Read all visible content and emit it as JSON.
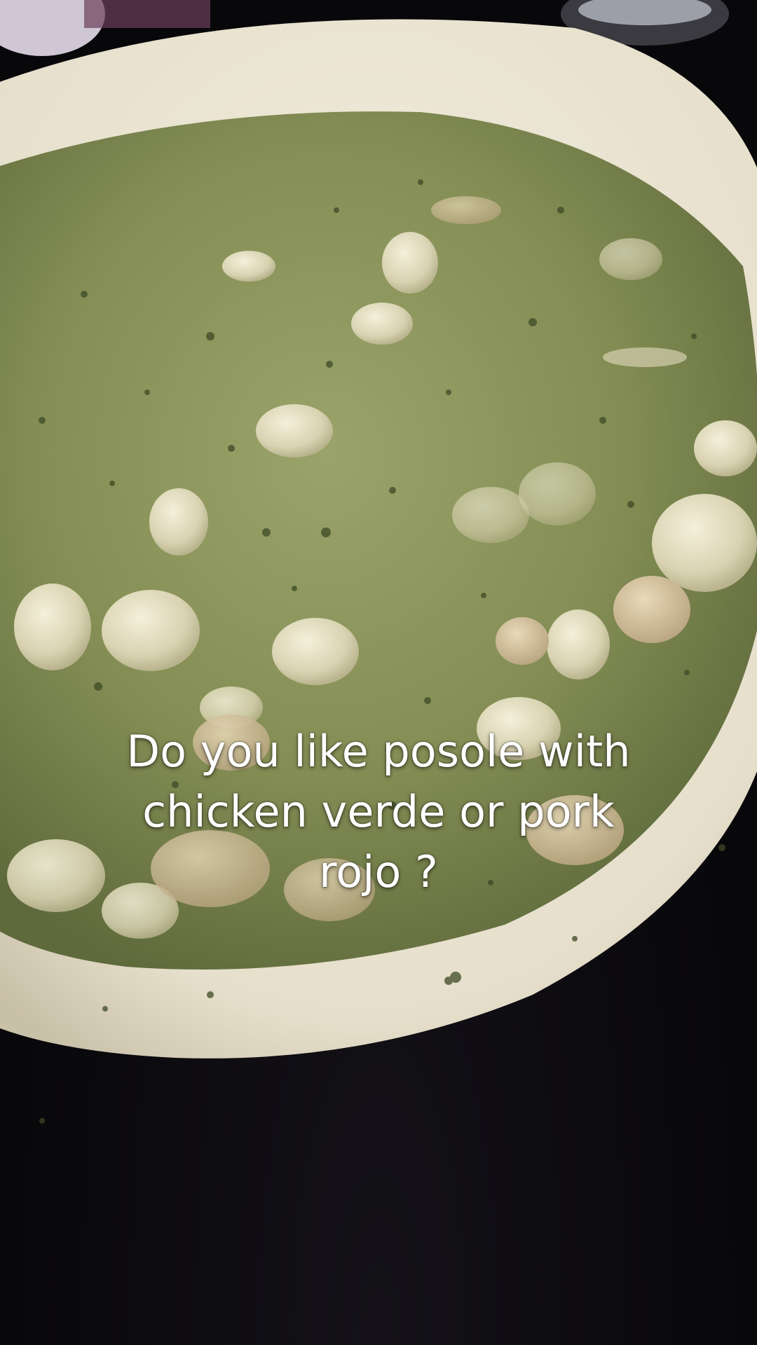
{
  "scene": {
    "subject": "bowl of green posole",
    "colors": {
      "background": "#0b0a0d",
      "bowl_rim": "#ece6d6",
      "broth": "#8f9a5e",
      "hominy": "#e7e2c8"
    }
  },
  "caption": {
    "line1": "Do you like posole with",
    "line2": "chicken verde or pork",
    "line3": "rojo ?"
  }
}
